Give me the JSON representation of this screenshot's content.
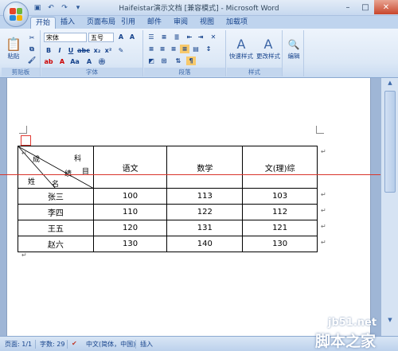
{
  "window": {
    "title": "Haifeistar演示文档 [兼容模式] - Microsoft Word"
  },
  "tabs": [
    "开始",
    "插入",
    "页面布局",
    "引用",
    "邮件",
    "审阅",
    "视图",
    "加载项"
  ],
  "ribbon": {
    "clipboard": {
      "paste": "粘贴",
      "label": "剪贴板"
    },
    "font": {
      "name": "宋体",
      "size": "五号",
      "label": "字体"
    },
    "paragraph": {
      "label": "段落"
    },
    "styles": {
      "quick": "快速样式",
      "change": "更改样式",
      "label": "样式"
    },
    "editing": {
      "label": "编辑"
    }
  },
  "table": {
    "diag_header": {
      "score": "成",
      "subject_1": "科",
      "subject_2": "目",
      "grade": "绩",
      "name_1": "姓",
      "name_2": "名"
    },
    "columns": [
      "语文",
      "数学",
      "文(理)综"
    ],
    "rows": [
      {
        "name": "张三",
        "chinese": "100",
        "math": "113",
        "comp": "103"
      },
      {
        "name": "李四",
        "chinese": "110",
        "math": "122",
        "comp": "112"
      },
      {
        "name": "王五",
        "chinese": "120",
        "math": "131",
        "comp": "121"
      },
      {
        "name": "赵六",
        "chinese": "130",
        "math": "140",
        "comp": "130"
      }
    ]
  },
  "status": {
    "page": "页面: 1/1",
    "words": "字数: 29",
    "language": "中文(简体，中国)",
    "mode": "插入"
  },
  "watermark": {
    "site": "jb51.net",
    "name": "脚本之家"
  },
  "colors": {
    "accent": "#15428b",
    "redline": "#d9342b"
  }
}
